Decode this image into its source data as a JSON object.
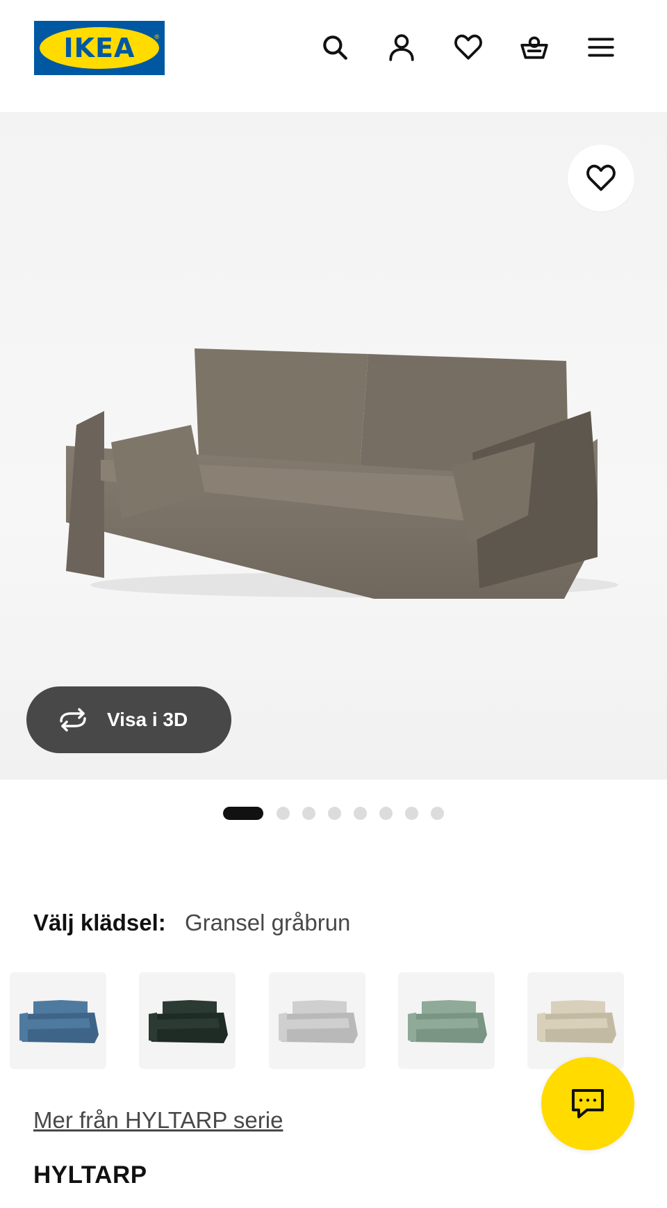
{
  "header": {
    "logo_text": "IKEA",
    "icons": [
      "search-icon",
      "profile-icon",
      "favourites-icon",
      "basket-icon",
      "menu-icon"
    ]
  },
  "gallery": {
    "view_3d_label": "Visa i 3D",
    "image_count": 8,
    "active_index": 0,
    "sofa_color": "#7a7267"
  },
  "upholstery": {
    "label": "Välj klädsel:",
    "value": "Gransel gråbrun",
    "swatches": [
      {
        "color": "#4e7aa0",
        "shadow": "#3e6588"
      },
      {
        "color": "#2b3a33",
        "shadow": "#1f2b25"
      },
      {
        "color": "#cfcfcf",
        "shadow": "#b9b9b9"
      },
      {
        "color": "#8faa98",
        "shadow": "#7a9583"
      },
      {
        "color": "#d8d0bb",
        "shadow": "#c3baa3"
      }
    ]
  },
  "series_link": "Mer från HYLTARP serie",
  "product": {
    "name": "HYLTARP"
  },
  "colors": {
    "brand_blue": "#0058a3",
    "brand_yellow": "#ffdb00",
    "dark_button": "#484848"
  }
}
